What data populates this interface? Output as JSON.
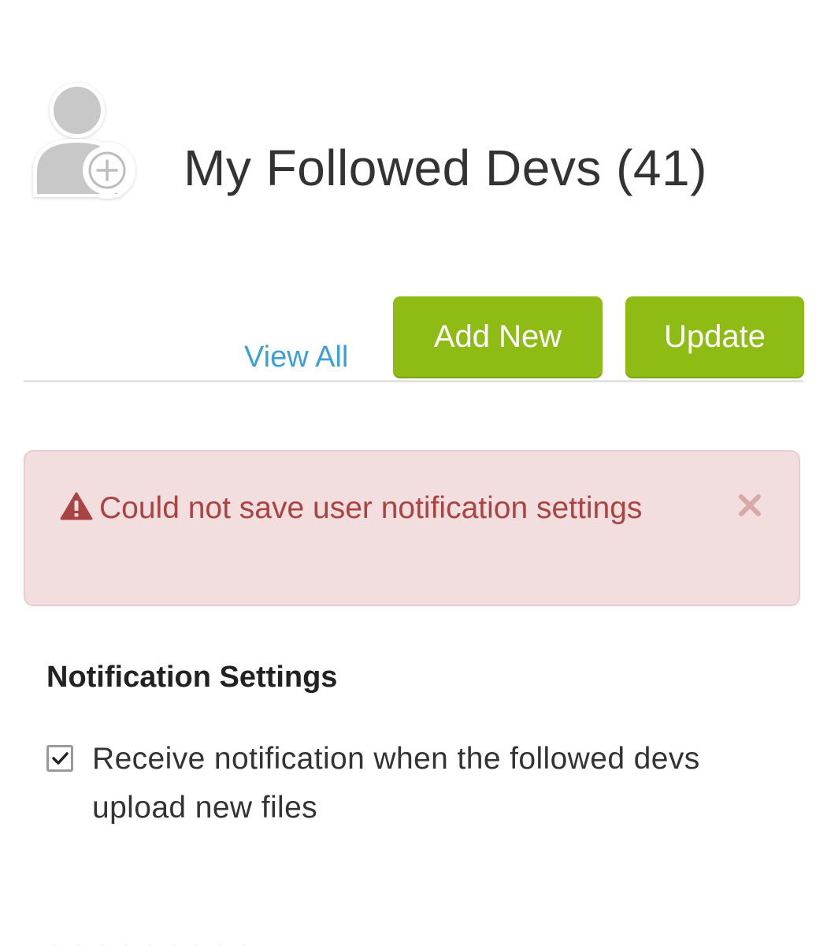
{
  "header": {
    "title": "My Followed Devs (41)",
    "avatar_icon": "user-add-icon"
  },
  "toolbar": {
    "view_all_label": "View All",
    "add_new_label": "Add New",
    "update_label": "Update"
  },
  "alert": {
    "type": "error",
    "message": "Could not save user notification settings",
    "icon": "warning-icon",
    "close_icon": "close-icon"
  },
  "notification_settings": {
    "heading": "Notification Settings",
    "option": {
      "label": "Receive notification when the followed devs upload new files",
      "checked": true
    }
  },
  "colors": {
    "accent_green": "#8fbc14",
    "link_blue": "#3ba0d9",
    "error_text": "#a94442",
    "error_bg": "#f2dede",
    "error_border": "#ebccd1"
  }
}
